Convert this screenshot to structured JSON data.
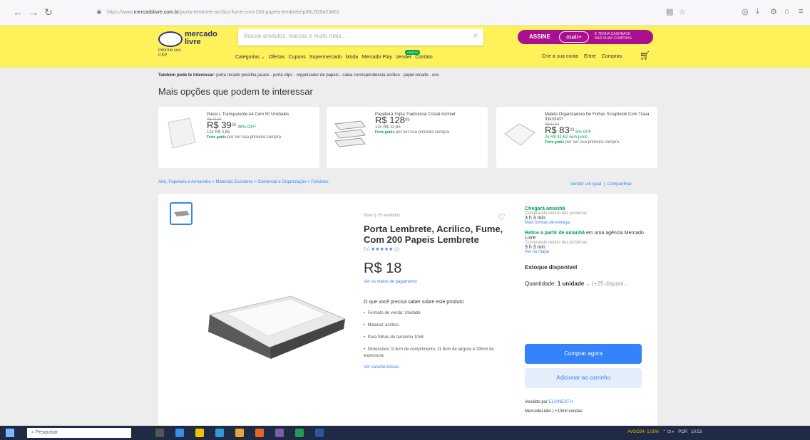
{
  "browser": {
    "url_prefix": "https://www.",
    "url_domain": "mercadolivre.com.br",
    "url_path": "/porta-lembrete-acrilico-fume-com-200-papeis-lembrete/p/MLB29423481"
  },
  "header": {
    "logo_text": "mercado\nlivre",
    "cep_label": "Informe seu\nCEP",
    "search_placeholder": "Buscar produtos, marcas e muito mais...",
    "assine": "ASSINE",
    "meli": "meli+",
    "cashback": "E TENHA CASHBACK\nNAS SUAS COMPRAS",
    "menu": [
      "Categorias ⌄",
      "Ofertas",
      "Cupons",
      "Supermercado",
      "Moda",
      "Mercado Play",
      "Vender",
      "Contato"
    ],
    "new_badge": "GRÁTIS",
    "account": [
      "Crie a sua conta",
      "Entre",
      "Compras"
    ]
  },
  "related": {
    "label": "Também pode te interessar:",
    "items": "porta recado presilha jacare - porta clips - organizador de papeis - caixa correspondencia acrilico - papel recado - env"
  },
  "more_title": "Mais opções que podem te interessar",
  "cards": [
    {
      "title": "Pasta L Transparente A4 Com 50 Unidades",
      "old": "R$ 76,00",
      "price": "R$ 39",
      "cents": "26",
      "off": "48% OFF",
      "install": "12x R$ 3,65",
      "free": "Frete grátis",
      "free_rest": " por ser sua primeira compra"
    },
    {
      "title": "Papeleira Tripla Tradicional Cristal Acrimet",
      "old": "",
      "price": "R$ 128",
      "cents": "99",
      "off": "",
      "install": "12x R$ 12,65",
      "free": "Frete grátis",
      "free_rest": " por ser sua primeira compra"
    },
    {
      "title": "Maleta Organizadora De Folhas Scrapbook Com Trava 33x33x07",
      "old": "R$ 87,62",
      "price": "R$ 83",
      "cents": "23",
      "off": "5% OFF",
      "install": "2x R$ 41,62 sem juros",
      "free": "Frete grátis",
      "free_rest": " por ser sua primeira compra"
    }
  ],
  "breadcrumbs": "Arte, Papelaria e Armarinho  >  Materiais Escolares  >  Comercial e Organização  >  Fichários",
  "share": {
    "sell": "Vender um igual",
    "share": "Compartilhar"
  },
  "product": {
    "condition": "Novo  |  +5 vendidos",
    "title": "Porta Lembrete, Acrilico, Fume, Com 200 Papeis Lembrete",
    "rating": "5.0",
    "stars": "★★★★★",
    "reviews": "(2)",
    "price": "R$ 18",
    "pay_link": "Ver os meios de pagamento",
    "know": "O que você precisa saber sobre este produto",
    "bullets": [
      "Formato de venda: Unidade",
      "Material: acrilico.",
      "Para folhas de tamanho 10x8.",
      "Dimensões: 9.3cm de comprimento, 11.8cm de largura e 29mm de espessura."
    ],
    "see_char": "Ver características"
  },
  "shipping": {
    "arrives": "Chegará amanhã",
    "buy_within": "Comprando dentro das próximas",
    "time": "3 h 3 min",
    "more_forms": "Mais formas de entrega",
    "pickup_green": "Retire a partir de amanhã",
    "pickup_rest": " em uma agência Mercado Livre",
    "buy_within2": "Comprando dentro das próximas",
    "time2": "3 h 3 min",
    "map": "Ver no mapa"
  },
  "stock": "Estoque disponível",
  "qty": {
    "label": "Quantidade: ",
    "value": "1 unidade",
    "avail": " ⌄  (+25 disponí..."
  },
  "buttons": {
    "buy": "Comprar agora",
    "add": "Adicionar ao carrinho"
  },
  "seller": {
    "label": "Vendido por ",
    "name": "ELIANESTH",
    "lider": "MercadoLíder",
    "sales": "  |  +10mil vendas"
  },
  "taskbar": {
    "search": "Pesquisar",
    "stock": "AVGO34  -1,05%",
    "lang": "POR",
    "time": "10:53"
  }
}
